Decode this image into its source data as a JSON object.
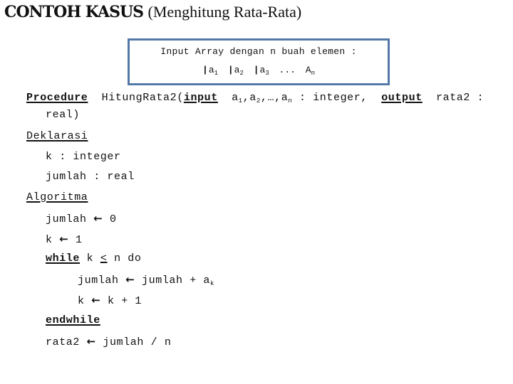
{
  "title": {
    "bold": "CONTOH KASUS",
    "rest": "(Menghitung Rata-Rata)"
  },
  "array_box": {
    "line1": "Input Array dengan n buah elemen :",
    "elements": [
      {
        "base": "a",
        "sub": "1"
      },
      {
        "base": "a",
        "sub": "2"
      },
      {
        "base": "a",
        "sub": "3"
      }
    ],
    "ellipsis": "...",
    "last": {
      "base": "A",
      "sub": "n"
    },
    "border_color": "#5478a8"
  },
  "procedure": {
    "keyword": "Procedure",
    "name": "HitungRata2(",
    "input_kw": "input",
    "params": [
      {
        "base": "a",
        "sub": "1"
      },
      {
        "base": "a",
        "sub": "2"
      }
    ],
    "params_sep": ",",
    "params_ellipsis": "…,",
    "param_last": {
      "base": "a",
      "sub": "n"
    },
    "input_type": " :  integer,",
    "output_kw": "output",
    "output_name": "rata2  :",
    "continuation": "real)"
  },
  "deklarasi": {
    "heading": "Deklarasi",
    "lines": [
      "k : integer",
      "jumlah : real"
    ]
  },
  "algoritma": {
    "heading": "Algoritma",
    "init1": {
      "lhs": "jumlah",
      "rhs": "0"
    },
    "init2": {
      "lhs": "k",
      "rhs": "1"
    },
    "while_kw": "while",
    "while_var": "k",
    "while_op": "<",
    "while_rest": "n do",
    "body1": {
      "lhs": "jumlah",
      "rhs": "jumlah + a",
      "rhs_sub": "k"
    },
    "body2": {
      "lhs": "k",
      "rhs": "k + 1"
    },
    "endwhile_kw": "endwhile",
    "final": {
      "lhs": "rata2",
      "rhs": "jumlah / n"
    }
  },
  "icons": {
    "assign": "←"
  }
}
